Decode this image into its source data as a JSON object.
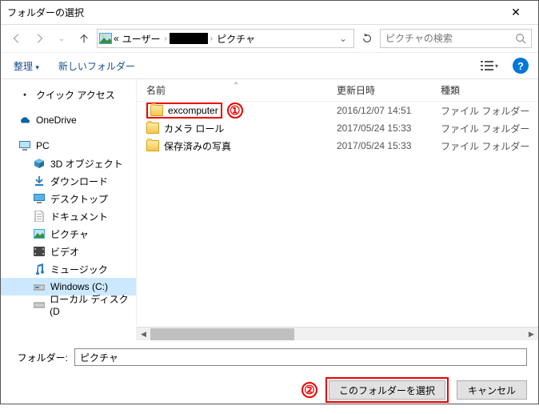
{
  "window": {
    "title": "フォルダーの選択"
  },
  "breadcrumb": {
    "prefix": "«",
    "seg1": "ユーザー",
    "seg3": "ピクチャ"
  },
  "search": {
    "placeholder": "ピクチャの検索"
  },
  "toolbar": {
    "organize": "整理",
    "newfolder": "新しいフォルダー"
  },
  "tree": {
    "quick": "クイック アクセス",
    "onedrive": "OneDrive",
    "pc": "PC",
    "obj3d": "3D オブジェクト",
    "downloads": "ダウンロード",
    "desktop": "デスクトップ",
    "documents": "ドキュメント",
    "pictures": "ピクチャ",
    "videos": "ビデオ",
    "music": "ミュージック",
    "cdrive": "Windows (C:)",
    "ddrive": "ローカル ディスク (D"
  },
  "columns": {
    "name": "名前",
    "modified": "更新日時",
    "type": "種類"
  },
  "files": [
    {
      "name": "excomputer",
      "date": "2016/12/07 14:51",
      "type": "ファイル フォルダー"
    },
    {
      "name": "カメラ ロール",
      "date": "2017/05/24 15:33",
      "type": "ファイル フォルダー"
    },
    {
      "name": "保存済みの写真",
      "date": "2017/05/24 15:33",
      "type": "ファイル フォルダー"
    }
  ],
  "annotations": {
    "one": "①",
    "two": "②"
  },
  "folderfield": {
    "label": "フォルダー:",
    "value": "ピクチャ"
  },
  "buttons": {
    "select": "このフォルダーを選択",
    "cancel": "キャンセル"
  }
}
